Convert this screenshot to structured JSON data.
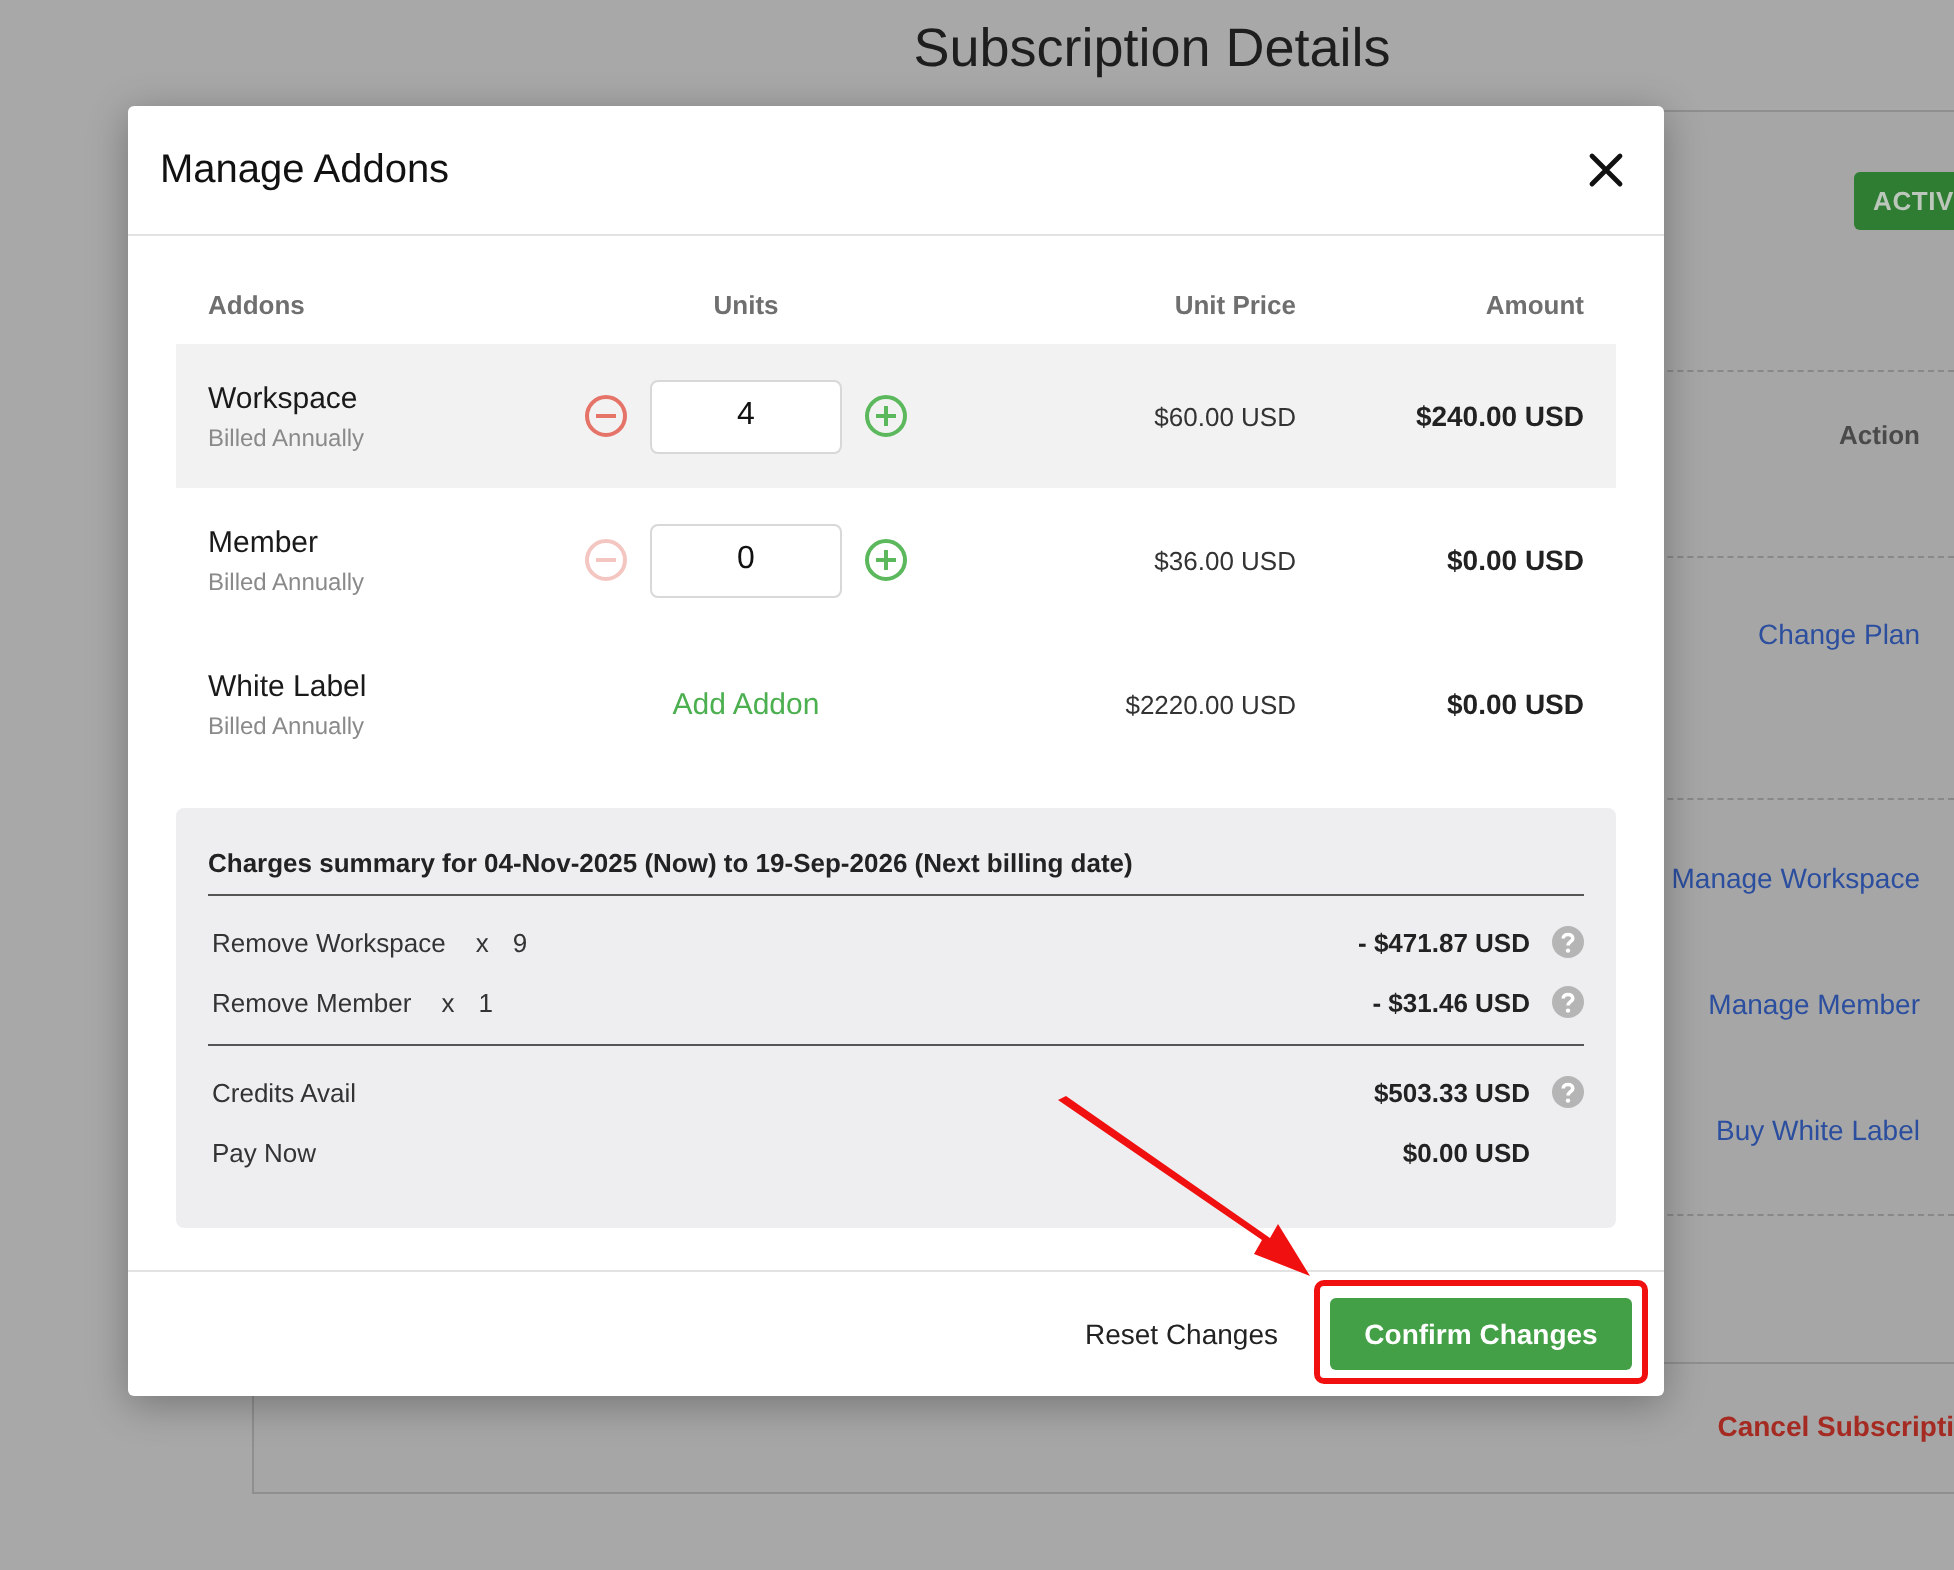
{
  "page": {
    "title": "Subscription Details",
    "status_badge": "ACTIV",
    "action_header": "Action",
    "plan_actions": [
      "Change Plan"
    ],
    "addon_actions": [
      "Manage Workspace",
      "Manage Member",
      "Buy White Label"
    ],
    "cancel_link": "Cancel Subscripti"
  },
  "dialog": {
    "title": "Manage Addons",
    "columns": [
      "Addons",
      "Units",
      "Unit Price",
      "Amount"
    ],
    "rows": [
      {
        "kind": "stepper",
        "name": "Workspace",
        "billing": "Billed Annually",
        "units": "4",
        "decrement_disabled": false,
        "highlighted": true,
        "unit_price": "$60.00 USD",
        "amount": "$240.00 USD"
      },
      {
        "kind": "stepper",
        "name": "Member",
        "billing": "Billed Annually",
        "units": "0",
        "decrement_disabled": true,
        "highlighted": false,
        "unit_price": "$36.00 USD",
        "amount": "$0.00 USD"
      },
      {
        "kind": "button",
        "name": "White Label",
        "billing": "Billed Annually",
        "action": "Add Addon",
        "highlighted": false,
        "unit_price": "$2220.00 USD",
        "amount": "$0.00 USD"
      }
    ],
    "summary": {
      "title": "Charges summary for 04-Nov-2025 (Now) to 19-Sep-2026 (Next billing date)",
      "items": [
        {
          "label": "Remove Workspace",
          "multiplier": "x",
          "quantity": "9",
          "amount": "- $471.87 USD",
          "help": true
        },
        {
          "label": "Remove Member",
          "multiplier": "x",
          "quantity": "1",
          "amount": "- $31.46 USD",
          "help": true
        }
      ],
      "totals": [
        {
          "label": "Credits Avail",
          "amount": "$503.33 USD",
          "help": true
        },
        {
          "label": "Pay Now",
          "amount": "$0.00 USD",
          "help": false
        }
      ]
    },
    "buttons": {
      "reset": "Reset Changes",
      "confirm": "Confirm Changes"
    }
  }
}
